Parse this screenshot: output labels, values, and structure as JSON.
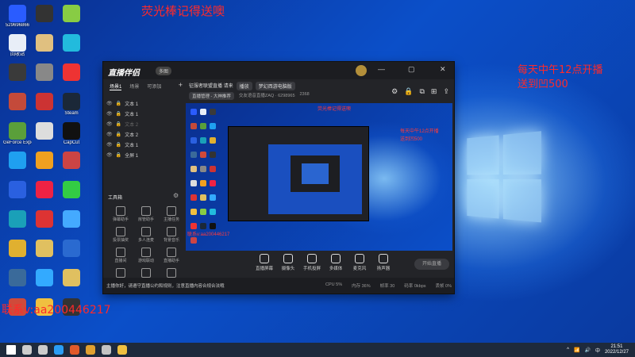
{
  "overlays": {
    "top_text": "荧光棒记得送噢",
    "right_line1": "每天中午12点开播",
    "right_line2": "送到凹500",
    "contact": "联系v:aa200446217"
  },
  "desktop_icons": [
    {
      "label": "529696866",
      "color": "#2a5cff"
    },
    {
      "label": "回收站",
      "color": "#e8eef7"
    },
    {
      "label": "",
      "color": "#3a3a3a"
    },
    {
      "label": "",
      "color": "#c44a3a"
    },
    {
      "label": "GeForce Experience",
      "color": "#5a9f3a"
    },
    {
      "label": "",
      "color": "#1fa0f0"
    },
    {
      "label": "",
      "color": "#2a60e0"
    },
    {
      "label": "",
      "color": "#1aa0b8"
    },
    {
      "label": "",
      "color": "#e0b030"
    },
    {
      "label": "",
      "color": "#3a6a9a"
    },
    {
      "label": "",
      "color": "#d04a3a"
    },
    {
      "label": "",
      "color": "#333"
    },
    {
      "label": "",
      "color": "#e0c080"
    },
    {
      "label": "",
      "color": "#888"
    },
    {
      "label": "",
      "color": "#c33"
    },
    {
      "label": "",
      "color": "#ddd"
    },
    {
      "label": "",
      "color": "#f0a020"
    },
    {
      "label": "",
      "color": "#e24"
    },
    {
      "label": "",
      "color": "#d33"
    },
    {
      "label": "",
      "color": "#e0c060"
    },
    {
      "label": "",
      "color": "#3af"
    },
    {
      "label": "",
      "color": "#f0c040"
    },
    {
      "label": "",
      "color": "#8c4"
    },
    {
      "label": "",
      "color": "#2bd"
    },
    {
      "label": "",
      "color": "#e33"
    },
    {
      "label": "Steam",
      "color": "#1b2838"
    },
    {
      "label": "CapCut",
      "color": "#111"
    },
    {
      "label": "",
      "color": "#c44"
    },
    {
      "label": "",
      "color": "#3c4"
    },
    {
      "label": "",
      "color": "#4af"
    },
    {
      "label": "",
      "color": "#2a6ad0"
    },
    {
      "label": "",
      "color": "#e0c060"
    },
    {
      "label": "",
      "color": "#333"
    }
  ],
  "app": {
    "logo": "直播伴侣",
    "badge": "多图",
    "window_controls": [
      "—",
      "▢",
      "✕"
    ],
    "tabs": [
      "场景1",
      "场景",
      "可添加"
    ],
    "active_tab": 0,
    "sources": [
      {
        "label": "文本 1",
        "dim": false
      },
      {
        "label": "文本 1",
        "dim": false
      },
      {
        "label": "文本 2",
        "dim": true
      },
      {
        "label": "文本 2",
        "dim": false
      },
      {
        "label": "文本 1",
        "dim": false
      },
      {
        "label": "全屏 1",
        "dim": false
      }
    ],
    "tools_title": "工具箱",
    "tools": [
      "弹幕助手",
      "房管助手",
      "主播任务",
      "投票抽奖",
      "多人连麦",
      "背景音乐",
      "直播间",
      "游戏联动",
      "直播助手",
      "礼物",
      "",
      ""
    ],
    "top_row1": [
      "征服者联盟直播 请来",
      "播放",
      "梦幻西游电脑版"
    ],
    "top_row2": [
      "直播管理 - 大神推荐",
      "交友语音直播ZAQ · 6298965",
      "2368"
    ],
    "top_icons": [
      "⚙",
      "🔒",
      "⧉",
      "⊞",
      "⇪",
      "⋯"
    ],
    "preview_notes": [
      "每天中午12点开播",
      "送到凹500",
      "荧光棒记得送噢",
      "联系v:aa200446217"
    ],
    "bottom_buttons": [
      "直播屏幕",
      "摄像头",
      "手机投屏",
      "多媒体",
      "麦克风",
      "扬声器"
    ],
    "start_live": "开始直播",
    "status_notice": "主播你好，请遵守直播公约和规则，注意直播内容合规合法哦",
    "status_stats": [
      "CPU 5%",
      "内存 36%",
      "帧率 30",
      "码率 0kbps",
      "丢帧 0%"
    ]
  },
  "taskbar": {
    "items": [
      "start",
      "search",
      "task-view",
      "edge",
      "app1",
      "app2",
      "app3",
      "app4"
    ],
    "tray": [
      "^",
      "📶",
      "🔊",
      "中"
    ],
    "time": "21:51",
    "date": "2022/12/27"
  }
}
